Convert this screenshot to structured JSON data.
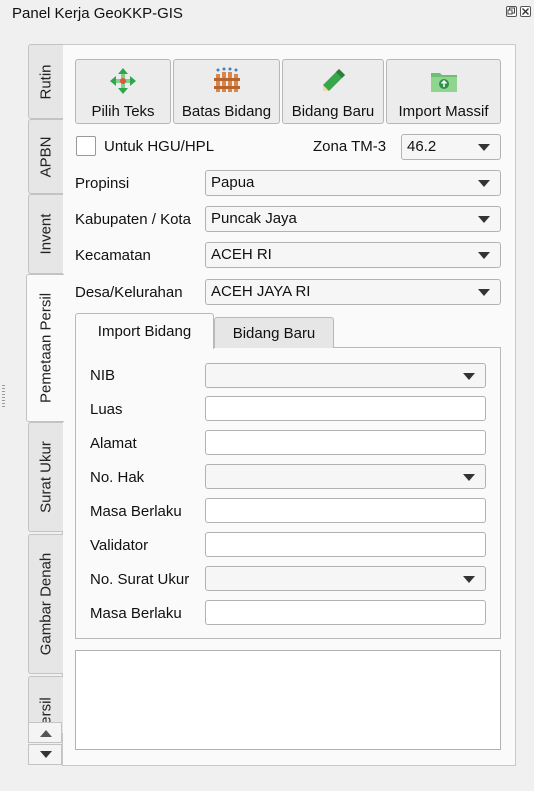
{
  "window": {
    "title": "Panel Kerja GeoKKP-GIS",
    "float_button_icon": "float-icon",
    "close_button_icon": "close-icon"
  },
  "side_tabs": [
    {
      "label": "Rutin"
    },
    {
      "label": "APBN"
    },
    {
      "label": "Invent"
    },
    {
      "label": "Pemetaan Persil",
      "active": true
    },
    {
      "label": "Surat Ukur"
    },
    {
      "label": "Gambar Denah"
    },
    {
      "label": "ersil"
    }
  ],
  "toolbar": [
    {
      "label": "Pilih Teks",
      "icon": "move-arrows-icon"
    },
    {
      "label": "Batas Bidang",
      "icon": "fence-icon"
    },
    {
      "label": "Bidang Baru",
      "icon": "pencil-icon"
    },
    {
      "label": "Import Massif",
      "icon": "folder-import-icon"
    }
  ],
  "hgu": {
    "checkbox_label": "Untuk HGU/HPL",
    "checked": false,
    "zona_label": "Zona TM-3",
    "zona_value": "46.2"
  },
  "location": {
    "propinsi_label": "Propinsi",
    "propinsi_value": "Papua",
    "kabupaten_label": "Kabupaten / Kota",
    "kabupaten_value": "Puncak Jaya",
    "kecamatan_label": "Kecamatan",
    "kecamatan_value": "ACEH RI",
    "desa_label": "Desa/Kelurahan",
    "desa_value": "ACEH JAYA RI"
  },
  "inner_tabs": [
    {
      "label": "Import Bidang",
      "active": true
    },
    {
      "label": "Bidang Baru",
      "active": false
    }
  ],
  "form": {
    "nib_label": "NIB",
    "nib_value": "",
    "luas_label": "Luas",
    "luas_value": "",
    "alamat_label": "Alamat",
    "alamat_value": "",
    "no_hak_label": "No. Hak",
    "no_hak_value": "",
    "masa_berlaku_label": "Masa Berlaku",
    "masa_berlaku_value": "",
    "validator_label": "Validator",
    "validator_value": "",
    "no_surat_ukur_label": "No. Surat Ukur",
    "no_surat_ukur_value": "",
    "masa_berlaku_2_label": "Masa Berlaku",
    "masa_berlaku_2_value": ""
  },
  "log_text": ""
}
